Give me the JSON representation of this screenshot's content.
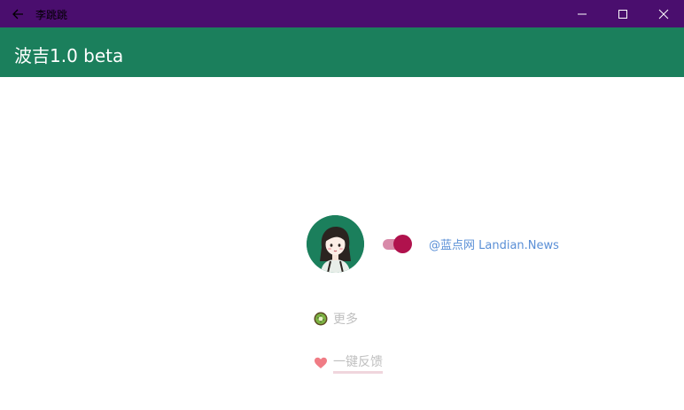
{
  "window": {
    "title": "李跳跳",
    "back_icon": "arrow-left-icon",
    "minimize_icon": "minimize-icon",
    "maximize_icon": "maximize-icon",
    "close_icon": "close-icon"
  },
  "appbar": {
    "title": "波吉1.0 beta",
    "color": "#1b7f5c"
  },
  "profile": {
    "avatar_icon": "girl-avatar-icon",
    "avatar_bg": "#1b7f5c",
    "toggle_on": true,
    "toggle_color": "#b0124d"
  },
  "watermark": {
    "text": "@蓝点网 Landian.News"
  },
  "actions": {
    "more": {
      "icon": "kiwi-icon",
      "label": "更多"
    },
    "feedback": {
      "icon": "heart-icon",
      "label": "一键反馈"
    }
  },
  "colors": {
    "titlebar": "#4a0e6e",
    "muted_text": "#bfbfbf",
    "link": "#5a8fd6"
  }
}
